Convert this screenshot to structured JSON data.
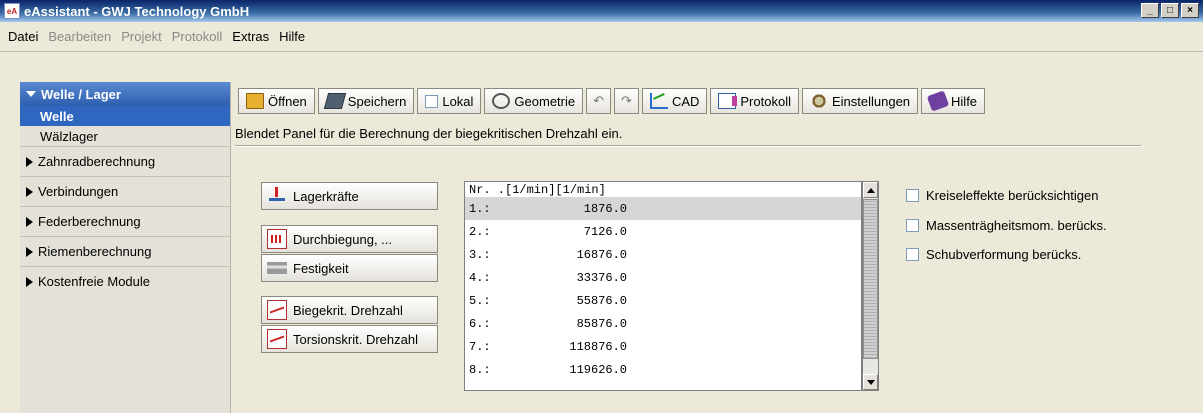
{
  "window": {
    "title": "eAssistant - GWJ Technology GmbH",
    "app_icon_text": "eA"
  },
  "window_buttons": {
    "minimize": "_",
    "maximize": "□",
    "close": "×"
  },
  "menu": [
    {
      "label": "Datei",
      "enabled": true
    },
    {
      "label": "Bearbeiten",
      "enabled": false
    },
    {
      "label": "Projekt",
      "enabled": false
    },
    {
      "label": "Protokoll",
      "enabled": false
    },
    {
      "label": "Extras",
      "enabled": true
    },
    {
      "label": "Hilfe",
      "enabled": true
    }
  ],
  "sidebar": {
    "section": "Welle / Lager",
    "sub_items": [
      "Welle",
      "Wälzlager"
    ],
    "groups": [
      "Zahnradberechnung",
      "Verbindungen",
      "Federberechnung",
      "Riemenberechnung",
      "Kostenfreie Module"
    ]
  },
  "toolbar": {
    "open": "Öffnen",
    "save": "Speichern",
    "local": "Lokal",
    "geometry": "Geometrie",
    "cad": "CAD",
    "protocol": "Protokoll",
    "settings": "Einstellungen",
    "help": "Hilfe"
  },
  "description": "Blendet Panel für die Berechnung der biegekritischen Drehzahl ein.",
  "actions": [
    "Lagerkräfte",
    "Durchbiegung, ...",
    "Festigkeit",
    "Biegekrit. Drehzahl",
    "Torsionskrit. Drehzahl"
  ],
  "results": {
    "header": "Nr. .[1/min][1/min]",
    "rows": [
      {
        "nr": "1.:",
        "value": "1876.0"
      },
      {
        "nr": "2.:",
        "value": "7126.0"
      },
      {
        "nr": "3.:",
        "value": "16876.0"
      },
      {
        "nr": "4.:",
        "value": "33376.0"
      },
      {
        "nr": "5.:",
        "value": "55876.0"
      },
      {
        "nr": "6.:",
        "value": "85876.0"
      },
      {
        "nr": "7.:",
        "value": "118876.0"
      },
      {
        "nr": "8.:",
        "value": "119626.0"
      }
    ]
  },
  "options": [
    "Kreiseleffekte berücksichtigen",
    "Massenträgheitsmom. berücks.",
    "Schubverformung berücks."
  ]
}
